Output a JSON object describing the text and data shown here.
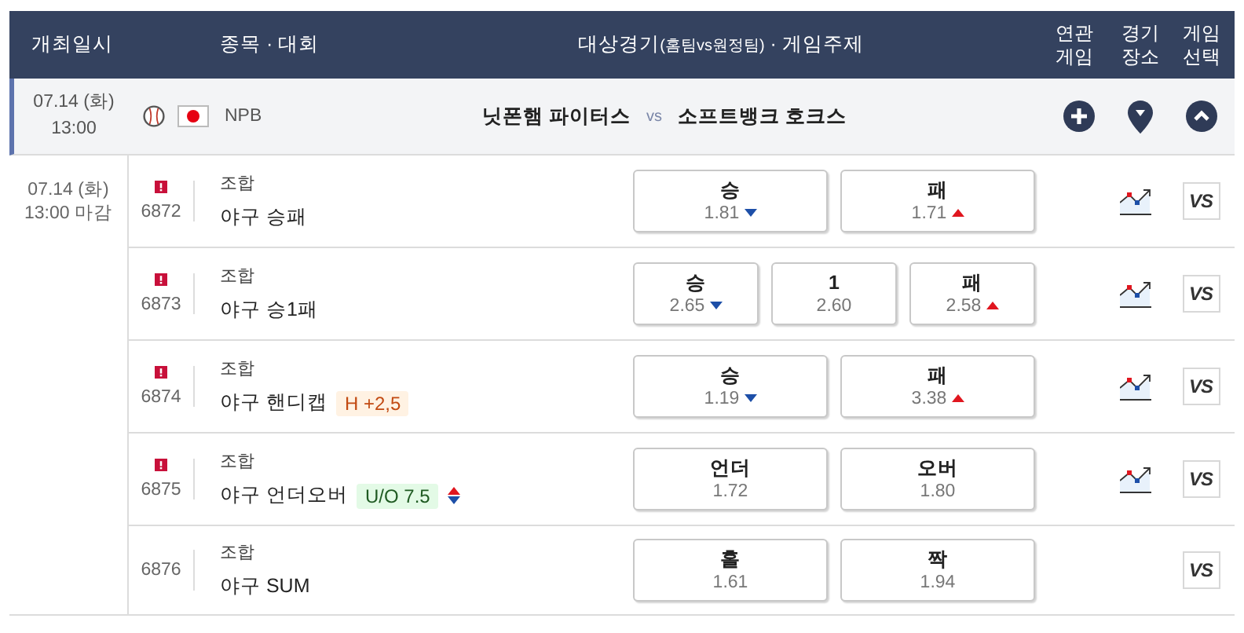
{
  "header": {
    "date": "개최일시",
    "sport": "종목 · 대회",
    "match": {
      "main": "대상경기",
      "sub": "(홈팀vs원정팀)",
      "tail": " · 게임주제"
    },
    "related": "연관 게임",
    "venue": "경기 장소",
    "select": "게임 선택"
  },
  "match": {
    "date": "07.14 (화)",
    "time": "13:00",
    "league": "NPB",
    "home": "닛폰햄 파이터스",
    "vs": "vs",
    "away": "소프트뱅크 호크스",
    "expanded": true
  },
  "deadline": {
    "date": "07.14 (화)",
    "time": "13:00 마감"
  },
  "games": [
    {
      "number": "6872",
      "alert": true,
      "type": "조합",
      "name": "야구 승패",
      "chart": true,
      "select": "VS",
      "odds": [
        {
          "label": "승",
          "value": "1.81",
          "up": false,
          "down": true
        },
        {
          "label": "패",
          "value": "1.71",
          "up": true,
          "down": false
        }
      ]
    },
    {
      "number": "6873",
      "alert": true,
      "type": "조합",
      "name": "야구 승1패",
      "chart": true,
      "select": "VS",
      "odds": [
        {
          "label": "승",
          "value": "2.65",
          "up": false,
          "down": true
        },
        {
          "label": "1",
          "value": "2.60",
          "up": false,
          "down": false
        },
        {
          "label": "패",
          "value": "2.58",
          "up": true,
          "down": false
        }
      ]
    },
    {
      "number": "6874",
      "alert": true,
      "type": "조합",
      "name": "야구 핸디캡",
      "badge": {
        "kind": "handicap",
        "text": "H +2,5",
        "up": false,
        "down": false
      },
      "chart": true,
      "select": "VS",
      "odds": [
        {
          "label": "승",
          "value": "1.19",
          "up": false,
          "down": true
        },
        {
          "label": "패",
          "value": "3.38",
          "up": true,
          "down": false
        }
      ]
    },
    {
      "number": "6875",
      "alert": true,
      "type": "조합",
      "name": "야구 언더오버",
      "badge": {
        "kind": "under-over",
        "text": "U/O 7.5",
        "up": true,
        "down": true
      },
      "chart": true,
      "select": "VS",
      "odds": [
        {
          "label": "언더",
          "value": "1.72",
          "up": false,
          "down": false
        },
        {
          "label": "오버",
          "value": "1.80",
          "up": false,
          "down": false
        }
      ]
    },
    {
      "number": "6876",
      "alert": false,
      "type": "조합",
      "name": "야구 SUM",
      "chart": false,
      "select": "VS",
      "odds": [
        {
          "label": "홀",
          "value": "1.61",
          "up": false,
          "down": false
        },
        {
          "label": "짝",
          "value": "1.94",
          "up": false,
          "down": false
        }
      ]
    }
  ]
}
